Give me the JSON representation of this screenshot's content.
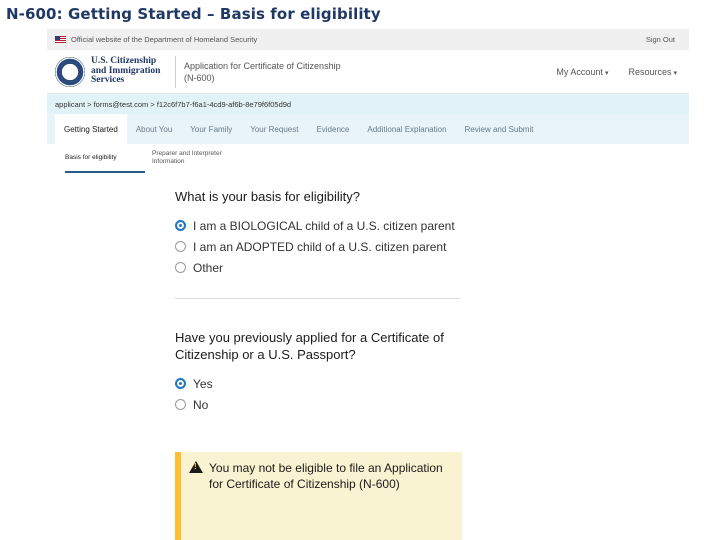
{
  "slide": {
    "title": "N-600: Getting Started – Basis for eligibility"
  },
  "banner": {
    "official_text": "Official website of the Department of Homeland Security",
    "sign_out": "Sign Out"
  },
  "header": {
    "agency_line1": "U.S. Citizenship",
    "agency_line2": "and Immigration",
    "agency_line3": "Services",
    "app_title_line1": "Application for Certificate of Citizenship",
    "app_title_line2": "(N-600)",
    "my_account": "My Account",
    "resources": "Resources"
  },
  "breadcrumb": {
    "text": "applicant  >  forms@test.com  >  f12c6f7b7-f6a1-4cd9-af6b-8e79f6f05d9d"
  },
  "step_tabs": [
    {
      "label": "Getting Started",
      "active": true
    },
    {
      "label": "About You",
      "active": false
    },
    {
      "label": "Your Family",
      "active": false
    },
    {
      "label": "Your Request",
      "active": false
    },
    {
      "label": "Evidence",
      "active": false
    },
    {
      "label": "Additional Explanation",
      "active": false
    },
    {
      "label": "Review and Submit",
      "active": false
    }
  ],
  "sub_tabs": [
    {
      "label": "Basis for eligibility",
      "active": true
    },
    {
      "label": "Preparer and Interpreter Information",
      "active": false
    }
  ],
  "eligibility": {
    "question": "What is your basis for eligibility?",
    "options": [
      {
        "label": "I am a BIOLOGICAL child of a U.S. citizen parent",
        "checked": true
      },
      {
        "label": "I am an ADOPTED child of a U.S. citizen parent",
        "checked": false
      },
      {
        "label": "Other",
        "checked": false
      }
    ]
  },
  "previous_application": {
    "question": "Have you previously applied for a Certificate of Citizenship or a U.S. Passport?",
    "options": [
      {
        "label": "Yes",
        "checked": true
      },
      {
        "label": "No",
        "checked": false
      }
    ]
  },
  "alert": {
    "icon": "warning-icon",
    "text": "You may not be eligible to file an Application for Certificate of Citizenship (N-600)"
  },
  "colors": {
    "title": "#1f3864",
    "breadcrumb_bg": "#e1f3f8",
    "tabs_bg": "#e8f4fa",
    "radio_selected": "#2378c3",
    "alert_bg": "#faf3d1",
    "alert_border": "#ffbe2e"
  }
}
